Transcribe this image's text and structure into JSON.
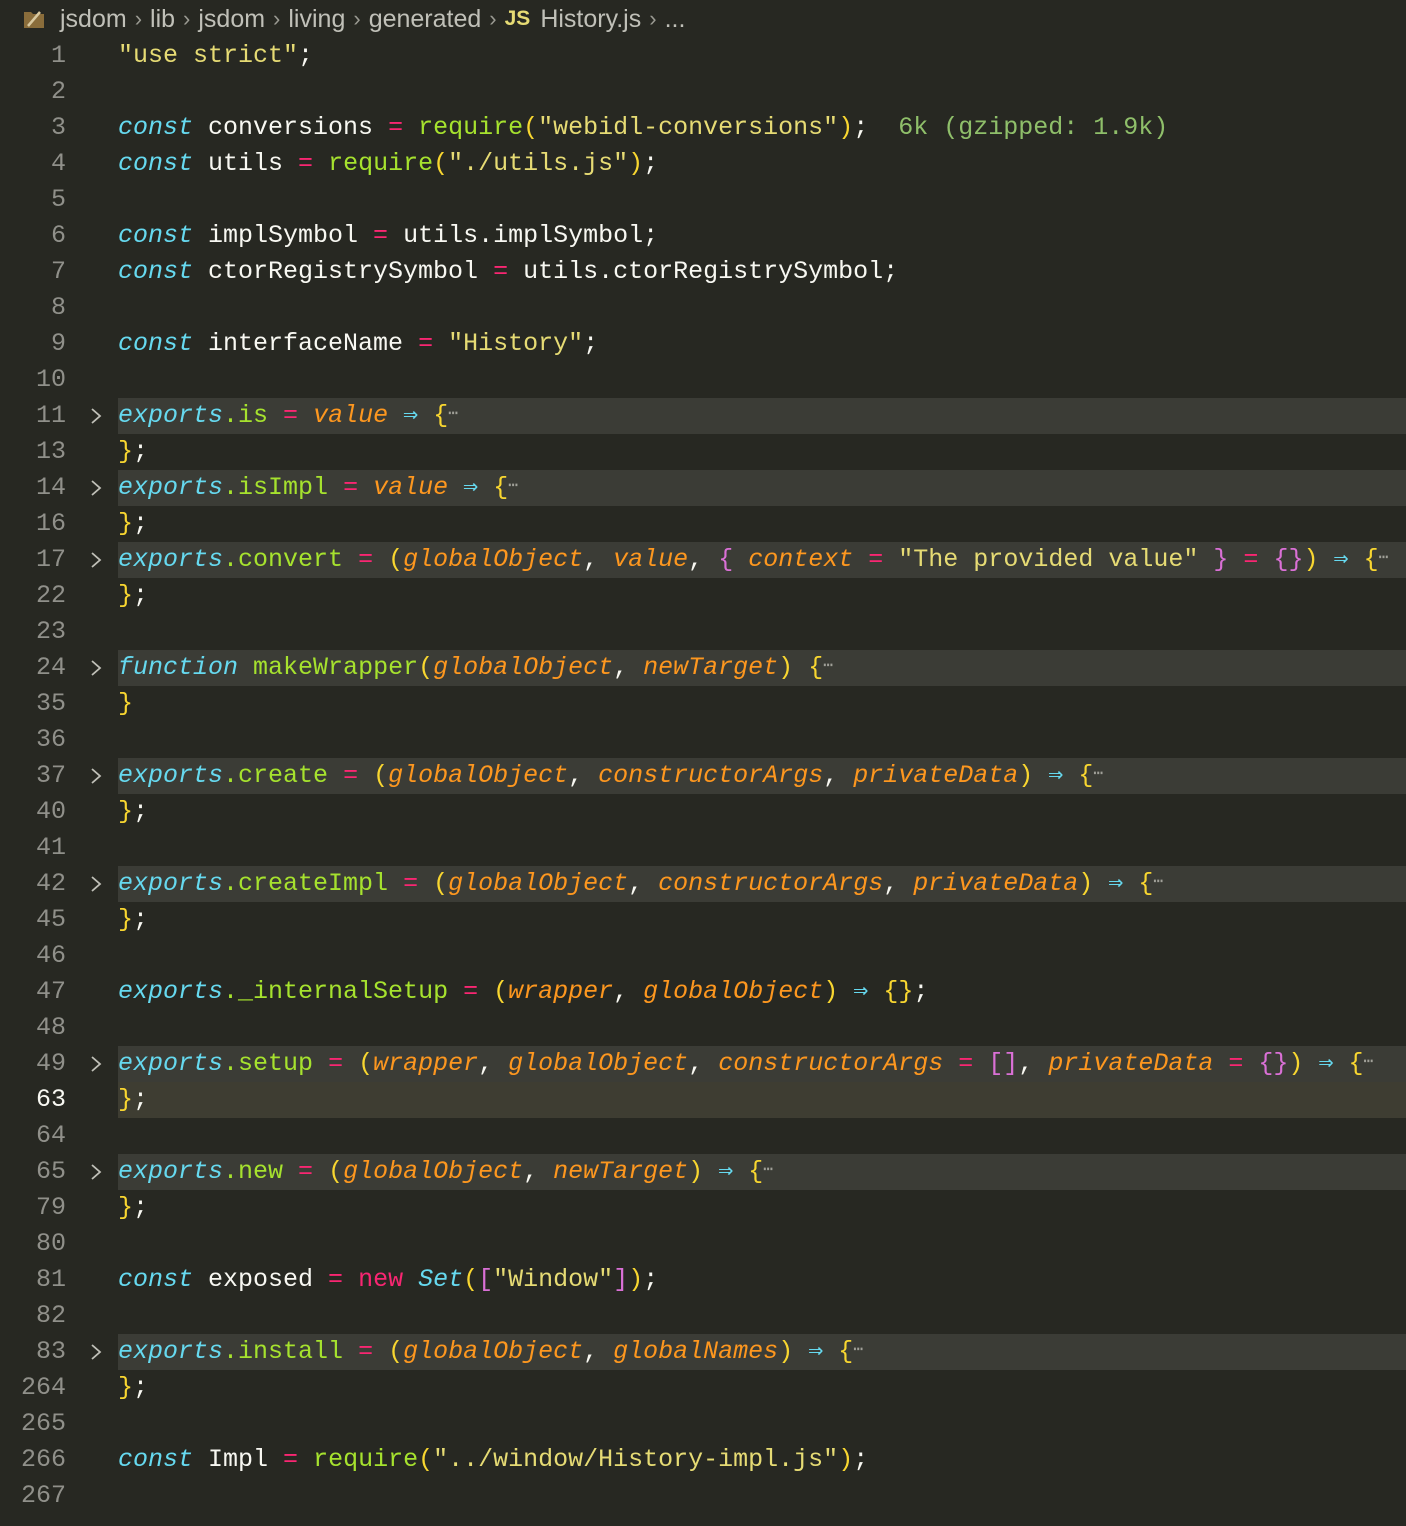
{
  "breadcrumb": {
    "items": [
      "jsdom",
      "lib",
      "jsdom",
      "living",
      "generated"
    ],
    "file_badge": "JS",
    "file_name": "History.js",
    "more": "..."
  },
  "lines": [
    {
      "num": "1",
      "tokens": [
        {
          "t": "\"use strict\"",
          "c": "tok-str"
        },
        {
          "t": ";",
          "c": "tok-plain"
        }
      ]
    },
    {
      "num": "2",
      "tokens": []
    },
    {
      "num": "3",
      "tokens": [
        {
          "t": "const",
          "c": "tok-kw"
        },
        {
          "t": " conversions ",
          "c": "tok-plain"
        },
        {
          "t": "=",
          "c": "tok-op"
        },
        {
          "t": " ",
          "c": "tok-plain"
        },
        {
          "t": "require",
          "c": "tok-fn"
        },
        {
          "t": "(",
          "c": "tok-brace"
        },
        {
          "t": "\"webidl-conversions\"",
          "c": "tok-str"
        },
        {
          "t": ")",
          "c": "tok-brace"
        },
        {
          "t": ";",
          "c": "tok-plain"
        },
        {
          "t": "  6k (gzipped: 1.9k)",
          "c": "tok-inlay"
        }
      ]
    },
    {
      "num": "4",
      "tokens": [
        {
          "t": "const",
          "c": "tok-kw"
        },
        {
          "t": " utils ",
          "c": "tok-plain"
        },
        {
          "t": "=",
          "c": "tok-op"
        },
        {
          "t": " ",
          "c": "tok-plain"
        },
        {
          "t": "require",
          "c": "tok-fn"
        },
        {
          "t": "(",
          "c": "tok-brace"
        },
        {
          "t": "\"./utils.js\"",
          "c": "tok-str"
        },
        {
          "t": ")",
          "c": "tok-brace"
        },
        {
          "t": ";",
          "c": "tok-plain"
        }
      ]
    },
    {
      "num": "5",
      "tokens": []
    },
    {
      "num": "6",
      "tokens": [
        {
          "t": "const",
          "c": "tok-kw"
        },
        {
          "t": " implSymbol ",
          "c": "tok-plain"
        },
        {
          "t": "=",
          "c": "tok-op"
        },
        {
          "t": " utils.implSymbol;",
          "c": "tok-plain"
        }
      ]
    },
    {
      "num": "7",
      "tokens": [
        {
          "t": "const",
          "c": "tok-kw"
        },
        {
          "t": " ctorRegistrySymbol ",
          "c": "tok-plain"
        },
        {
          "t": "=",
          "c": "tok-op"
        },
        {
          "t": " utils.ctorRegistrySymbol;",
          "c": "tok-plain"
        }
      ]
    },
    {
      "num": "8",
      "tokens": []
    },
    {
      "num": "9",
      "tokens": [
        {
          "t": "const",
          "c": "tok-kw"
        },
        {
          "t": " interfaceName ",
          "c": "tok-plain"
        },
        {
          "t": "=",
          "c": "tok-op"
        },
        {
          "t": " ",
          "c": "tok-plain"
        },
        {
          "t": "\"History\"",
          "c": "tok-str"
        },
        {
          "t": ";",
          "c": "tok-plain"
        }
      ]
    },
    {
      "num": "10",
      "tokens": []
    },
    {
      "num": "11",
      "fold": true,
      "tokens": [
        {
          "t": "exports",
          "c": "tok-kw"
        },
        {
          "t": ".is ",
          "c": "tok-fn"
        },
        {
          "t": "=",
          "c": "tok-op"
        },
        {
          "t": " ",
          "c": "tok-plain"
        },
        {
          "t": "value",
          "c": "tok-param"
        },
        {
          "t": " ",
          "c": "tok-plain"
        },
        {
          "t": "⇒",
          "c": "tok-arrow"
        },
        {
          "t": " ",
          "c": "tok-plain"
        },
        {
          "t": "{",
          "c": "tok-brace"
        }
      ]
    },
    {
      "num": "13",
      "tokens": [
        {
          "t": "}",
          "c": "tok-brace"
        },
        {
          "t": ";",
          "c": "tok-plain"
        }
      ]
    },
    {
      "num": "14",
      "fold": true,
      "tokens": [
        {
          "t": "exports",
          "c": "tok-kw"
        },
        {
          "t": ".isImpl ",
          "c": "tok-fn"
        },
        {
          "t": "=",
          "c": "tok-op"
        },
        {
          "t": " ",
          "c": "tok-plain"
        },
        {
          "t": "value",
          "c": "tok-param"
        },
        {
          "t": " ",
          "c": "tok-plain"
        },
        {
          "t": "⇒",
          "c": "tok-arrow"
        },
        {
          "t": " ",
          "c": "tok-plain"
        },
        {
          "t": "{",
          "c": "tok-brace"
        }
      ]
    },
    {
      "num": "16",
      "tokens": [
        {
          "t": "}",
          "c": "tok-brace"
        },
        {
          "t": ";",
          "c": "tok-plain"
        }
      ]
    },
    {
      "num": "17",
      "fold": true,
      "tokens": [
        {
          "t": "exports",
          "c": "tok-kw"
        },
        {
          "t": ".convert ",
          "c": "tok-fn"
        },
        {
          "t": "=",
          "c": "tok-op"
        },
        {
          "t": " ",
          "c": "tok-plain"
        },
        {
          "t": "(",
          "c": "tok-brace"
        },
        {
          "t": "globalObject",
          "c": "tok-param"
        },
        {
          "t": ", ",
          "c": "tok-plain"
        },
        {
          "t": "value",
          "c": "tok-param"
        },
        {
          "t": ", ",
          "c": "tok-plain"
        },
        {
          "t": "{",
          "c": "tok-brace2"
        },
        {
          "t": " ",
          "c": "tok-plain"
        },
        {
          "t": "context",
          "c": "tok-param"
        },
        {
          "t": " ",
          "c": "tok-plain"
        },
        {
          "t": "=",
          "c": "tok-op"
        },
        {
          "t": " ",
          "c": "tok-plain"
        },
        {
          "t": "\"The provided value\"",
          "c": "tok-str"
        },
        {
          "t": " ",
          "c": "tok-plain"
        },
        {
          "t": "}",
          "c": "tok-brace2"
        },
        {
          "t": " ",
          "c": "tok-plain"
        },
        {
          "t": "=",
          "c": "tok-op"
        },
        {
          "t": " ",
          "c": "tok-plain"
        },
        {
          "t": "{}",
          "c": "tok-brace2"
        },
        {
          "t": ")",
          "c": "tok-brace"
        },
        {
          "t": " ",
          "c": "tok-plain"
        },
        {
          "t": "⇒",
          "c": "tok-arrow"
        },
        {
          "t": " ",
          "c": "tok-plain"
        },
        {
          "t": "{",
          "c": "tok-brace"
        }
      ]
    },
    {
      "num": "22",
      "tokens": [
        {
          "t": "}",
          "c": "tok-brace"
        },
        {
          "t": ";",
          "c": "tok-plain"
        }
      ]
    },
    {
      "num": "23",
      "tokens": []
    },
    {
      "num": "24",
      "fold": true,
      "tokens": [
        {
          "t": "function",
          "c": "tok-kw"
        },
        {
          "t": " ",
          "c": "tok-plain"
        },
        {
          "t": "makeWrapper",
          "c": "tok-fn"
        },
        {
          "t": "(",
          "c": "tok-brace"
        },
        {
          "t": "globalObject",
          "c": "tok-param"
        },
        {
          "t": ", ",
          "c": "tok-plain"
        },
        {
          "t": "newTarget",
          "c": "tok-param"
        },
        {
          "t": ")",
          "c": "tok-brace"
        },
        {
          "t": " ",
          "c": "tok-plain"
        },
        {
          "t": "{",
          "c": "tok-brace"
        }
      ]
    },
    {
      "num": "35",
      "tokens": [
        {
          "t": "}",
          "c": "tok-brace"
        }
      ]
    },
    {
      "num": "36",
      "tokens": []
    },
    {
      "num": "37",
      "fold": true,
      "tokens": [
        {
          "t": "exports",
          "c": "tok-kw"
        },
        {
          "t": ".create ",
          "c": "tok-fn"
        },
        {
          "t": "=",
          "c": "tok-op"
        },
        {
          "t": " ",
          "c": "tok-plain"
        },
        {
          "t": "(",
          "c": "tok-brace"
        },
        {
          "t": "globalObject",
          "c": "tok-param"
        },
        {
          "t": ", ",
          "c": "tok-plain"
        },
        {
          "t": "constructorArgs",
          "c": "tok-param"
        },
        {
          "t": ", ",
          "c": "tok-plain"
        },
        {
          "t": "privateData",
          "c": "tok-param"
        },
        {
          "t": ")",
          "c": "tok-brace"
        },
        {
          "t": " ",
          "c": "tok-plain"
        },
        {
          "t": "⇒",
          "c": "tok-arrow"
        },
        {
          "t": " ",
          "c": "tok-plain"
        },
        {
          "t": "{",
          "c": "tok-brace"
        }
      ]
    },
    {
      "num": "40",
      "tokens": [
        {
          "t": "}",
          "c": "tok-brace"
        },
        {
          "t": ";",
          "c": "tok-plain"
        }
      ]
    },
    {
      "num": "41",
      "tokens": []
    },
    {
      "num": "42",
      "fold": true,
      "tokens": [
        {
          "t": "exports",
          "c": "tok-kw"
        },
        {
          "t": ".createImpl ",
          "c": "tok-fn"
        },
        {
          "t": "=",
          "c": "tok-op"
        },
        {
          "t": " ",
          "c": "tok-plain"
        },
        {
          "t": "(",
          "c": "tok-brace"
        },
        {
          "t": "globalObject",
          "c": "tok-param"
        },
        {
          "t": ", ",
          "c": "tok-plain"
        },
        {
          "t": "constructorArgs",
          "c": "tok-param"
        },
        {
          "t": ", ",
          "c": "tok-plain"
        },
        {
          "t": "privateData",
          "c": "tok-param"
        },
        {
          "t": ")",
          "c": "tok-brace"
        },
        {
          "t": " ",
          "c": "tok-plain"
        },
        {
          "t": "⇒",
          "c": "tok-arrow"
        },
        {
          "t": " ",
          "c": "tok-plain"
        },
        {
          "t": "{",
          "c": "tok-brace"
        }
      ]
    },
    {
      "num": "45",
      "tokens": [
        {
          "t": "}",
          "c": "tok-brace"
        },
        {
          "t": ";",
          "c": "tok-plain"
        }
      ]
    },
    {
      "num": "46",
      "tokens": []
    },
    {
      "num": "47",
      "tokens": [
        {
          "t": "exports",
          "c": "tok-kw"
        },
        {
          "t": "._internalSetup ",
          "c": "tok-fn"
        },
        {
          "t": "=",
          "c": "tok-op"
        },
        {
          "t": " ",
          "c": "tok-plain"
        },
        {
          "t": "(",
          "c": "tok-brace"
        },
        {
          "t": "wrapper",
          "c": "tok-param"
        },
        {
          "t": ", ",
          "c": "tok-plain"
        },
        {
          "t": "globalObject",
          "c": "tok-param"
        },
        {
          "t": ")",
          "c": "tok-brace"
        },
        {
          "t": " ",
          "c": "tok-plain"
        },
        {
          "t": "⇒",
          "c": "tok-arrow"
        },
        {
          "t": " ",
          "c": "tok-plain"
        },
        {
          "t": "{}",
          "c": "tok-brace"
        },
        {
          "t": ";",
          "c": "tok-plain"
        }
      ]
    },
    {
      "num": "48",
      "tokens": []
    },
    {
      "num": "49",
      "fold": true,
      "tokens": [
        {
          "t": "exports",
          "c": "tok-kw"
        },
        {
          "t": ".setup ",
          "c": "tok-fn"
        },
        {
          "t": "=",
          "c": "tok-op"
        },
        {
          "t": " ",
          "c": "tok-plain"
        },
        {
          "t": "(",
          "c": "tok-brace"
        },
        {
          "t": "wrapper",
          "c": "tok-param"
        },
        {
          "t": ", ",
          "c": "tok-plain"
        },
        {
          "t": "globalObject",
          "c": "tok-param"
        },
        {
          "t": ", ",
          "c": "tok-plain"
        },
        {
          "t": "constructorArgs",
          "c": "tok-param"
        },
        {
          "t": " ",
          "c": "tok-plain"
        },
        {
          "t": "=",
          "c": "tok-op"
        },
        {
          "t": " ",
          "c": "tok-plain"
        },
        {
          "t": "[]",
          "c": "tok-brace2"
        },
        {
          "t": ", ",
          "c": "tok-plain"
        },
        {
          "t": "privateData",
          "c": "tok-param"
        },
        {
          "t": " ",
          "c": "tok-plain"
        },
        {
          "t": "=",
          "c": "tok-op"
        },
        {
          "t": " ",
          "c": "tok-plain"
        },
        {
          "t": "{}",
          "c": "tok-brace2"
        },
        {
          "t": ")",
          "c": "tok-brace"
        },
        {
          "t": " ",
          "c": "tok-plain"
        },
        {
          "t": "⇒",
          "c": "tok-arrow"
        },
        {
          "t": " ",
          "c": "tok-plain"
        },
        {
          "t": "{",
          "c": "tok-brace"
        }
      ]
    },
    {
      "num": "63",
      "active": true,
      "tokens": [
        {
          "t": "}",
          "c": "tok-brace"
        },
        {
          "t": ";",
          "c": "tok-plain"
        }
      ]
    },
    {
      "num": "64",
      "tokens": []
    },
    {
      "num": "65",
      "fold": true,
      "tokens": [
        {
          "t": "exports",
          "c": "tok-kw"
        },
        {
          "t": ".new ",
          "c": "tok-fn"
        },
        {
          "t": "=",
          "c": "tok-op"
        },
        {
          "t": " ",
          "c": "tok-plain"
        },
        {
          "t": "(",
          "c": "tok-brace"
        },
        {
          "t": "globalObject",
          "c": "tok-param"
        },
        {
          "t": ", ",
          "c": "tok-plain"
        },
        {
          "t": "newTarget",
          "c": "tok-param"
        },
        {
          "t": ")",
          "c": "tok-brace"
        },
        {
          "t": " ",
          "c": "tok-plain"
        },
        {
          "t": "⇒",
          "c": "tok-arrow"
        },
        {
          "t": " ",
          "c": "tok-plain"
        },
        {
          "t": "{",
          "c": "tok-brace"
        }
      ]
    },
    {
      "num": "79",
      "tokens": [
        {
          "t": "}",
          "c": "tok-brace"
        },
        {
          "t": ";",
          "c": "tok-plain"
        }
      ]
    },
    {
      "num": "80",
      "tokens": []
    },
    {
      "num": "81",
      "tokens": [
        {
          "t": "const",
          "c": "tok-kw"
        },
        {
          "t": " exposed ",
          "c": "tok-plain"
        },
        {
          "t": "=",
          "c": "tok-op"
        },
        {
          "t": " ",
          "c": "tok-plain"
        },
        {
          "t": "new",
          "c": "tok-kwnew"
        },
        {
          "t": " ",
          "c": "tok-plain"
        },
        {
          "t": "Set",
          "c": "tok-class"
        },
        {
          "t": "(",
          "c": "tok-brace"
        },
        {
          "t": "[",
          "c": "tok-brace2"
        },
        {
          "t": "\"Window\"",
          "c": "tok-str"
        },
        {
          "t": "]",
          "c": "tok-brace2"
        },
        {
          "t": ")",
          "c": "tok-brace"
        },
        {
          "t": ";",
          "c": "tok-plain"
        }
      ]
    },
    {
      "num": "82",
      "tokens": []
    },
    {
      "num": "83",
      "fold": true,
      "tokens": [
        {
          "t": "exports",
          "c": "tok-kw"
        },
        {
          "t": ".install ",
          "c": "tok-fn"
        },
        {
          "t": "=",
          "c": "tok-op"
        },
        {
          "t": " ",
          "c": "tok-plain"
        },
        {
          "t": "(",
          "c": "tok-brace"
        },
        {
          "t": "globalObject",
          "c": "tok-param"
        },
        {
          "t": ", ",
          "c": "tok-plain"
        },
        {
          "t": "globalNames",
          "c": "tok-param"
        },
        {
          "t": ")",
          "c": "tok-brace"
        },
        {
          "t": " ",
          "c": "tok-plain"
        },
        {
          "t": "⇒",
          "c": "tok-arrow"
        },
        {
          "t": " ",
          "c": "tok-plain"
        },
        {
          "t": "{",
          "c": "tok-brace"
        }
      ]
    },
    {
      "num": "264",
      "tokens": [
        {
          "t": "}",
          "c": "tok-brace"
        },
        {
          "t": ";",
          "c": "tok-plain"
        }
      ]
    },
    {
      "num": "265",
      "tokens": []
    },
    {
      "num": "266",
      "tokens": [
        {
          "t": "const",
          "c": "tok-kw"
        },
        {
          "t": " Impl ",
          "c": "tok-plain"
        },
        {
          "t": "=",
          "c": "tok-op"
        },
        {
          "t": " ",
          "c": "tok-plain"
        },
        {
          "t": "require",
          "c": "tok-fn"
        },
        {
          "t": "(",
          "c": "tok-brace"
        },
        {
          "t": "\"../window/History-impl.js\"",
          "c": "tok-str"
        },
        {
          "t": ")",
          "c": "tok-brace"
        },
        {
          "t": ";",
          "c": "tok-plain"
        }
      ]
    },
    {
      "num": "267",
      "tokens": []
    }
  ],
  "fold_placeholder": "⋯",
  "colors": {
    "background": "#272822",
    "folded_line": "#3b3c36",
    "keyword": "#66d9ef",
    "string": "#e6db74",
    "operator": "#f92672",
    "function": "#a6e22e",
    "parameter": "#fd971f"
  },
  "icons": {
    "folder": "folder-icon",
    "fold": "chevron-right-icon"
  }
}
